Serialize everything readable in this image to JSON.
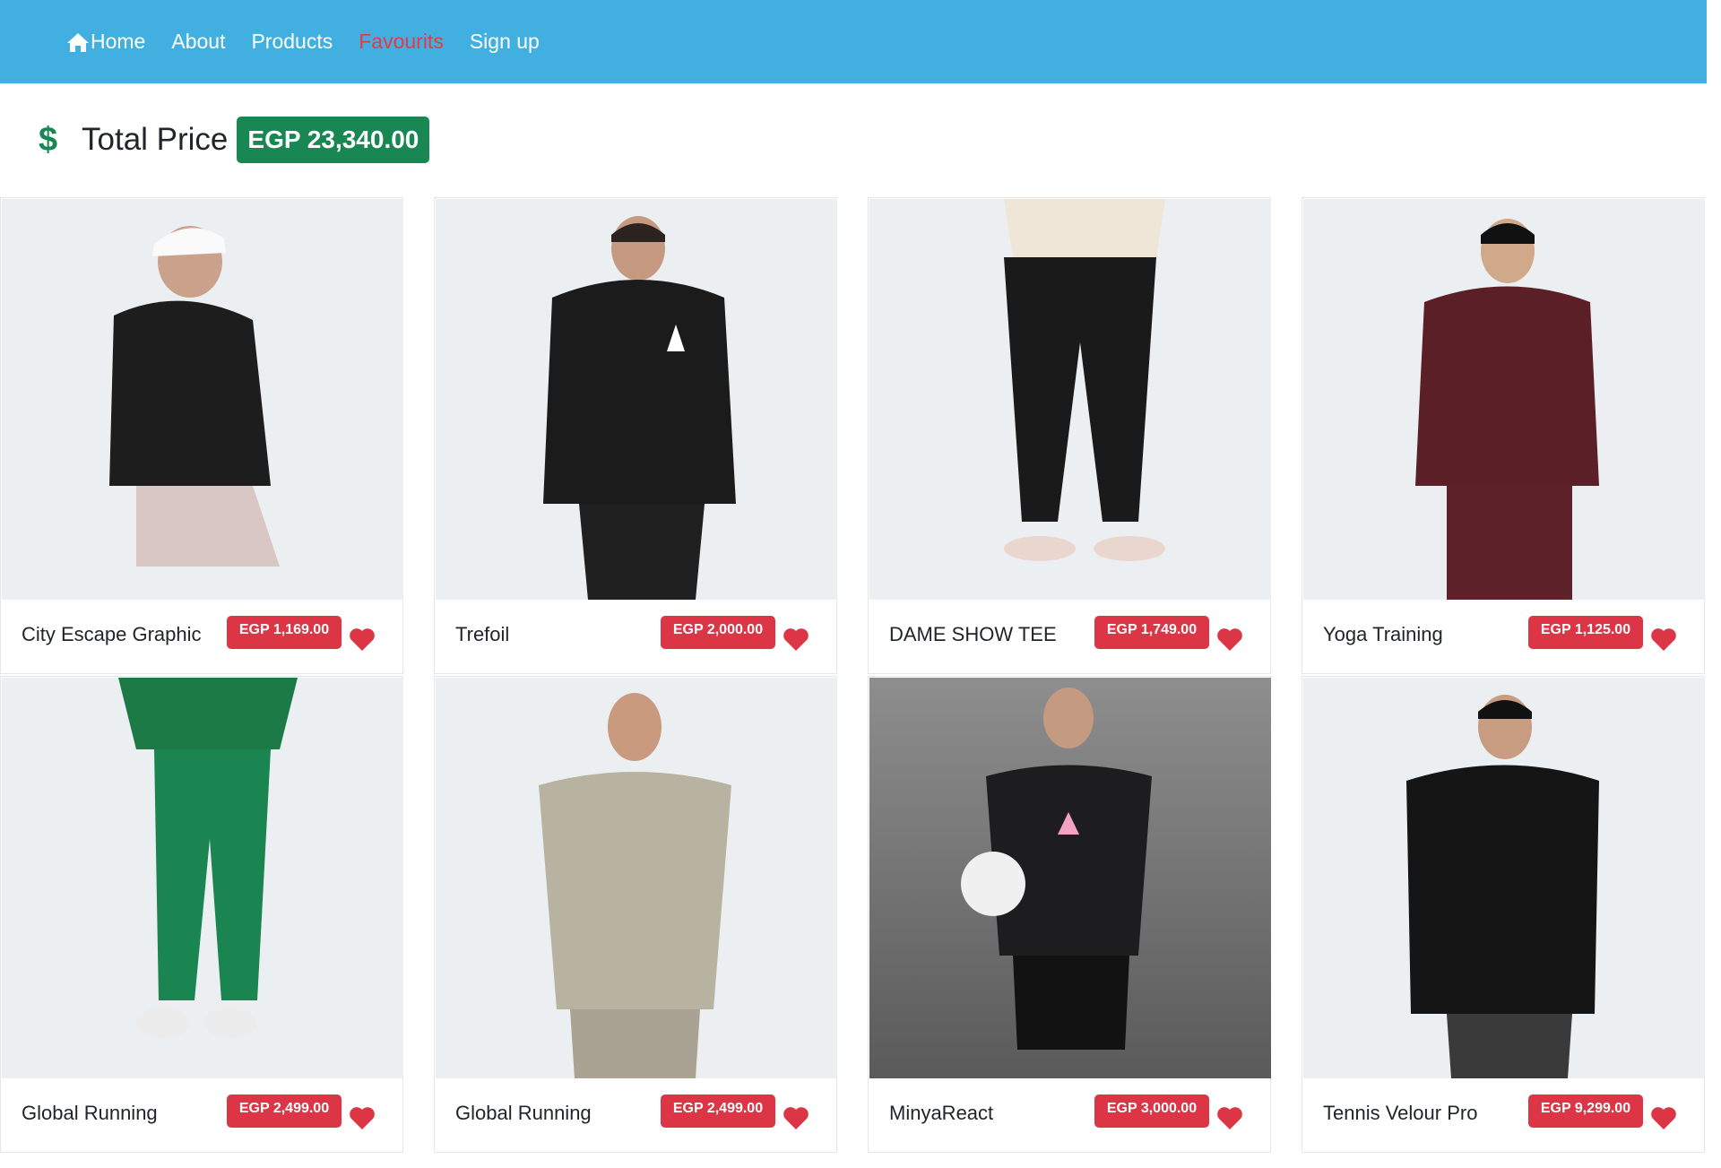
{
  "nav": {
    "items": [
      {
        "label": "Home",
        "icon": "home-icon"
      },
      {
        "label": "About"
      },
      {
        "label": "Products"
      },
      {
        "label": "Favourits",
        "active": true
      },
      {
        "label": "Sign up"
      }
    ]
  },
  "total": {
    "icon": "dollar-icon",
    "label": "Total Price",
    "value": "EGP 23,340.00"
  },
  "products": [
    {
      "title": "City Escape Graphic",
      "price": "EGP 1,169.00"
    },
    {
      "title": "Trefoil",
      "price": "EGP 2,000.00"
    },
    {
      "title": "DAME SHOW TEE",
      "price": "EGP 1,749.00"
    },
    {
      "title": "Yoga Training",
      "price": "EGP 1,125.00"
    },
    {
      "title": "Global Running",
      "price": "EGP 2,499.00"
    },
    {
      "title": "Global Running",
      "price": "EGP 2,499.00"
    },
    {
      "title": "MinyaReact",
      "price": "EGP 3,000.00"
    },
    {
      "title": "Tennis Velour Pro",
      "price": "EGP 9,299.00"
    }
  ],
  "colors": {
    "navbar": "#41b0e1",
    "active_link": "#e53945",
    "total_badge": "#198754",
    "price_badge": "#dc3545",
    "heart": "#dc3545"
  }
}
